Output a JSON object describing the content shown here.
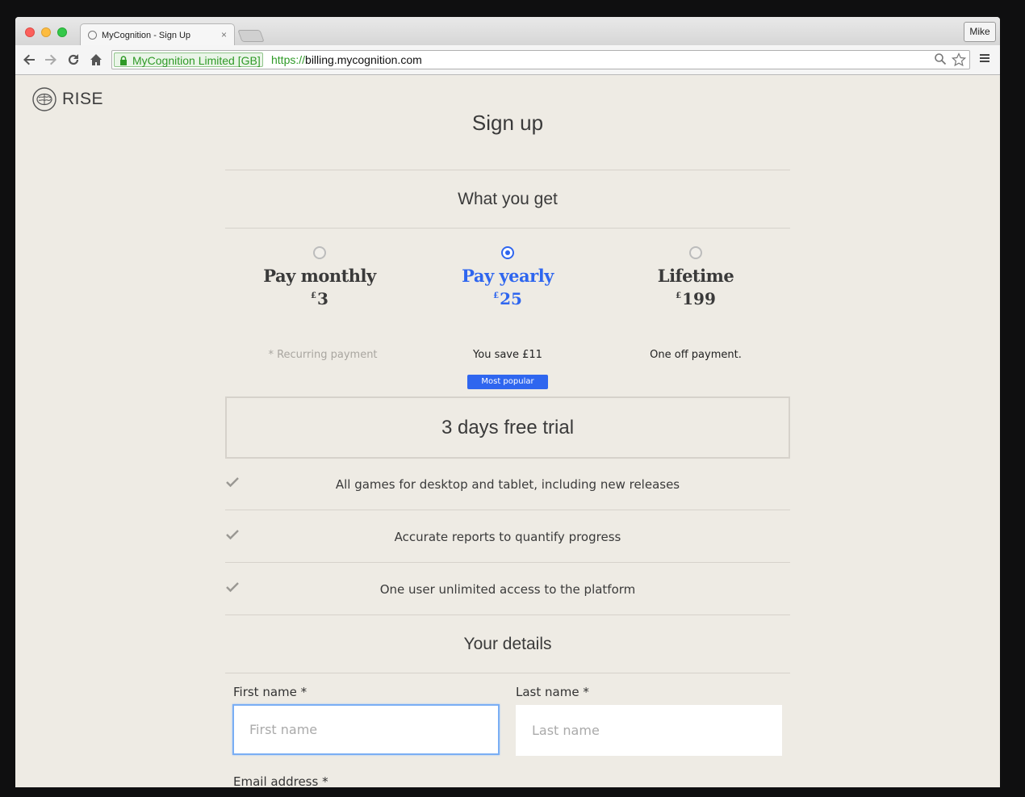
{
  "browser": {
    "tab_title": "MyCognition - Sign Up",
    "tab_close": "×",
    "profile_name": "Mike",
    "ev_label": "MyCognition Limited [GB]",
    "url_scheme": "https://",
    "url_host": "billing.mycognition.com"
  },
  "brand": {
    "name": "RISE"
  },
  "page": {
    "title": "Sign up"
  },
  "what_you_get": {
    "title": "What you get",
    "plans": [
      {
        "name": "Pay monthly",
        "currency": "£",
        "amount": "3",
        "note": "* Recurring payment",
        "selected": false
      },
      {
        "name": "Pay yearly",
        "currency": "£",
        "amount": "25",
        "note": "You save £11",
        "selected": true,
        "badge": "Most popular"
      },
      {
        "name": "Lifetime",
        "currency": "£",
        "amount": "199",
        "note": "One off payment.",
        "selected": false
      }
    ]
  },
  "trial": {
    "label": "3 days free trial"
  },
  "features": [
    "All games for desktop and tablet, including new releases",
    "Accurate reports to quantify progress",
    "One user unlimited access to the platform"
  ],
  "details": {
    "title": "Your details",
    "first_name_label": "First name *",
    "first_name_placeholder": "First name",
    "last_name_label": "Last name *",
    "last_name_placeholder": "Last name",
    "email_label": "Email address *"
  },
  "colors": {
    "accent": "#2f66ef",
    "background": "#eeebe4",
    "ev_green": "#2f9a27"
  }
}
